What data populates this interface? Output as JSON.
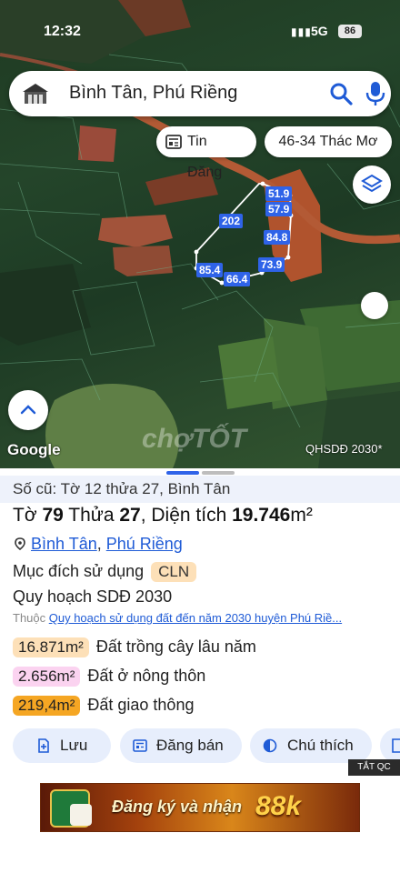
{
  "status_bar": {
    "time": "12:32",
    "signal": "▮▮▮",
    "network": "5G",
    "battery": "86"
  },
  "search": {
    "query": "Bình Tân, Phú Riềng"
  },
  "chips": {
    "news": "Tin Đăng",
    "road": "46-34 Thác Mơ"
  },
  "map": {
    "dimensions": [
      "51.9",
      "57.9",
      "202",
      "84.8",
      "73.9",
      "85.4",
      "66.4"
    ],
    "google_logo": "Google",
    "watermark": "chợTỐT",
    "layer_label": "QHSDĐ 2030*",
    "boundary_color": "#ffffff",
    "label_color": "#2f63e8"
  },
  "sheet": {
    "old_info": "Số cũ: Tờ 12 thửa 27, Bình Tân",
    "parcel": {
      "sheet_label": "Tờ ",
      "sheet_no": "79",
      "lot_label": " Thửa ",
      "lot_no": "27",
      "area_label": ", Diện tích ",
      "area_value": "19.746",
      "area_unit": "m²"
    },
    "location": {
      "ward": "Bình Tân",
      "separator": ", ",
      "district": "Phú Riềng"
    },
    "purpose_label": "Mục đích sử dụng",
    "purpose_code": "CLN",
    "plan_label": "Quy hoạch SDĐ 2030",
    "source_prefix": "Thuộc ",
    "source_link": "Quy hoạch sử dụng đất đến năm 2030 huyện Phú Riề...",
    "areas": [
      {
        "value": "16.871m²",
        "label": "Đất trồng cây lâu năm",
        "color": "#fde0b8"
      },
      {
        "value": "2.656m²",
        "label": "Đất ở nông thôn",
        "color": "#fbd3f0"
      },
      {
        "value": "219,4m²",
        "label": "Đất giao thông",
        "color": "#f5a623"
      }
    ],
    "actions": {
      "save": "Lưu",
      "sell": "Đăng bán",
      "note": "Chú thích"
    },
    "close_ad": "TẮT QC",
    "ad": {
      "text": "Đăng ký và nhận",
      "highlight": "88k"
    }
  }
}
